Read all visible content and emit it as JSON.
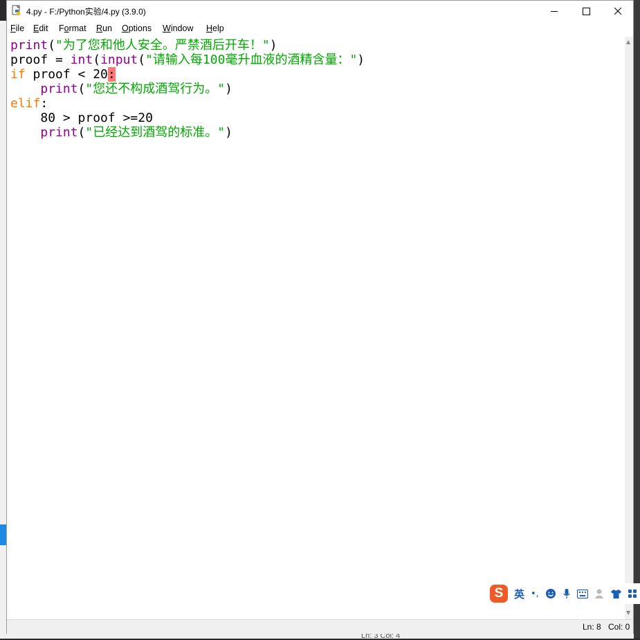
{
  "window": {
    "title": "4.py - F:/Python实验/4.py (3.9.0)",
    "controls": {
      "minimize": "—",
      "maximize": "☐",
      "close": "✕"
    }
  },
  "menu": {
    "file": {
      "u": "F",
      "rest": "ile"
    },
    "edit": {
      "u": "E",
      "rest": "dit"
    },
    "format": {
      "pre": "F",
      "u": "o",
      "rest": "rmat"
    },
    "run": {
      "u": "R",
      "rest": "un"
    },
    "options": {
      "u": "O",
      "rest": "ptions"
    },
    "window": {
      "u": "W",
      "rest": "indow"
    },
    "help": {
      "u": "H",
      "rest": "elp"
    }
  },
  "code": {
    "line1": {
      "fn": "print",
      "open": "(",
      "str": "\"为了您和他人安全。严禁酒后开车！\"",
      "close": ")"
    },
    "line2": {
      "var": "proof = ",
      "fn": "int",
      "open1": "(",
      "fn2": "input",
      "open2": "(",
      "str": "\"请输入每100毫升血液的酒精含量：\"",
      "close": ")"
    },
    "line3": {
      "kw": "if",
      "cond": " proof < 20",
      "colon": ":"
    },
    "line4": {
      "indent": "    ",
      "fn": "print",
      "open": "(",
      "str": "\"您还不构成酒驾行为。\"",
      "close": ")"
    },
    "line5": {
      "kw": "elif",
      "colon": ":"
    },
    "line6": {
      "indent": "    ",
      "text": "80 > proof >=20"
    },
    "line7": {
      "indent": "    ",
      "fn": "print",
      "open": "(",
      "str": "\"已经达到酒驾的标准。\"",
      "close": ")"
    }
  },
  "status": {
    "line": "Ln: 8",
    "col": "Col: 0"
  },
  "behind_window_status": "Ln: 3   Col: 4",
  "ime": {
    "logo": "S",
    "lang": "英",
    "punct": "•,",
    "icons": [
      "emoji-icon",
      "microphone-icon",
      "keyboard-icon",
      "user-icon",
      "shirt-icon",
      "grid-icon"
    ]
  },
  "colors": {
    "keyword": "#ff7700",
    "builtin": "#900090",
    "string": "#00aa00",
    "cursor_highlight": "#ff7777",
    "ime_brand": "#ef5a28",
    "ime_icons": "#1a5fb4"
  }
}
